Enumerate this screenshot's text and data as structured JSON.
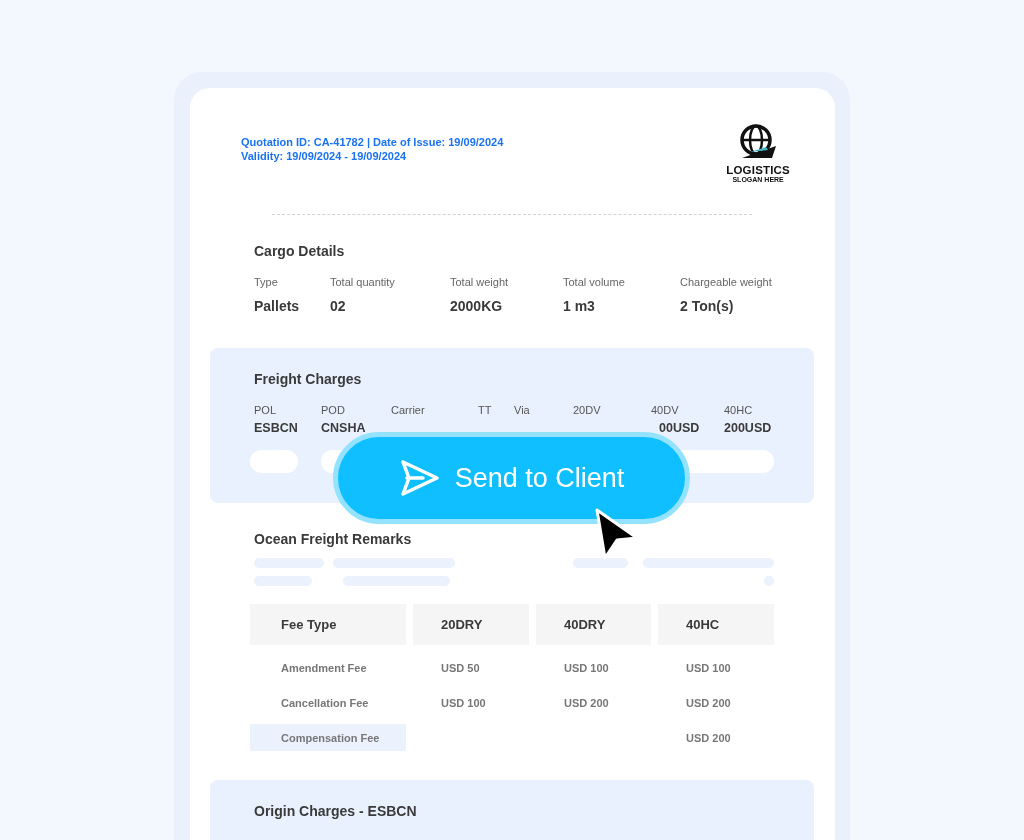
{
  "quotation": {
    "line_1": "Quotation ID: CA-41782 | Date of Issue: 19/09/2024",
    "line_2": "Validity: 19/09/2024 - 19/09/2024"
  },
  "logo": {
    "name": "LOGISTICS",
    "slogan": "SLOGAN HERE"
  },
  "cargo_details": {
    "title": "Cargo Details",
    "fields": [
      {
        "label": "Type",
        "value": "Pallets"
      },
      {
        "label": "Total quantity",
        "value": "02"
      },
      {
        "label": "Total weight",
        "value": "2000KG"
      },
      {
        "label": "Total volume",
        "value": "1 m3"
      },
      {
        "label": "Chargeable weight",
        "value": "2 Ton(s)"
      }
    ]
  },
  "freight_charges": {
    "title": "Freight Charges",
    "columns": [
      {
        "label": "POL",
        "value": "ESBCN"
      },
      {
        "label": "POD",
        "value": "CNSHA"
      },
      {
        "label": "Carrier"
      },
      {
        "label": "TT"
      },
      {
        "label": "Via"
      },
      {
        "label": "20DV"
      },
      {
        "label": "40DV",
        "value": "00USD"
      },
      {
        "label": "40HC",
        "value": "200USD"
      }
    ]
  },
  "ocean_freight_remarks": {
    "title": "Ocean Freight Remarks"
  },
  "fee_table": {
    "columns": [
      "Fee Type",
      "20DRY",
      "40DRY",
      "40HC"
    ],
    "rows": [
      {
        "fee": "Amendment Fee",
        "dry_20": "USD 50",
        "dry_40": "USD 100",
        "hc_40": "USD 100",
        "selected": false
      },
      {
        "fee": "Cancellation Fee",
        "dry_20": "USD 100",
        "dry_40": "USD 200",
        "hc_40": "USD 200",
        "selected": false
      },
      {
        "fee": "Compensation Fee",
        "hc_40": "USD 200",
        "selected": true
      }
    ]
  },
  "send_button": {
    "label": "Send to Client"
  },
  "origin_charges": {
    "title": "Origin Charges - ESBCN"
  }
}
